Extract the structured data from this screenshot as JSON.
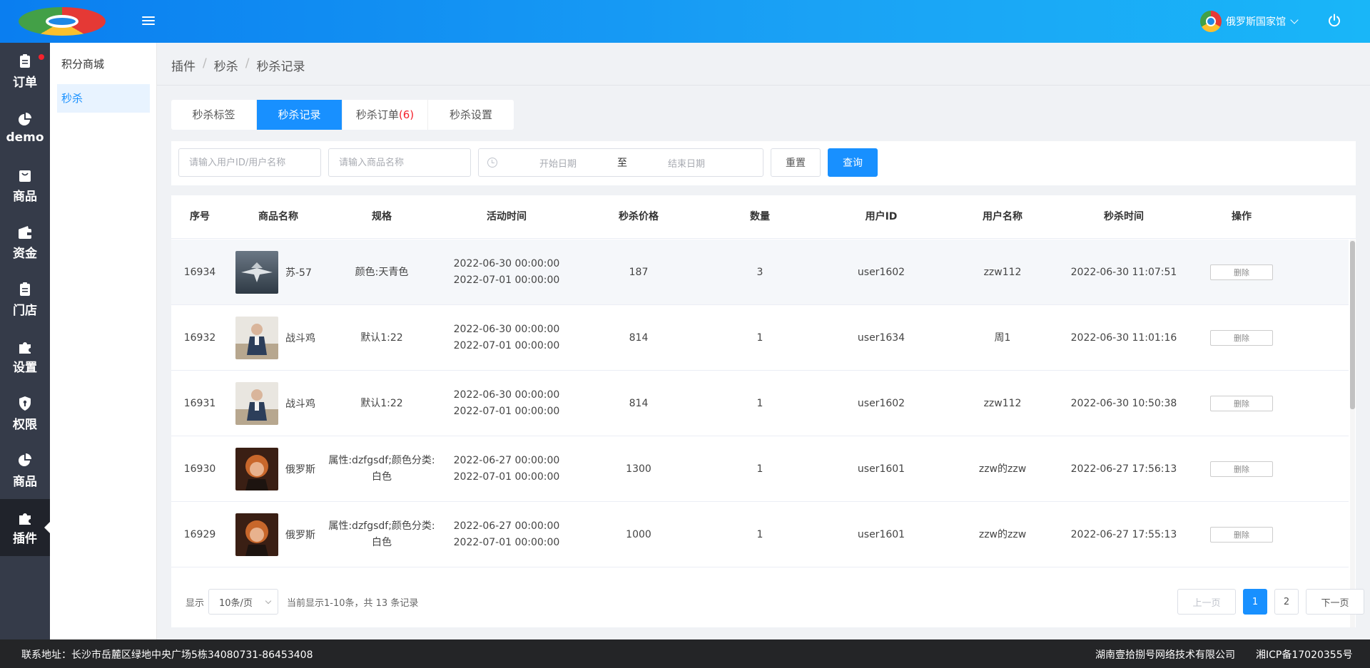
{
  "header": {
    "user_name": "俄罗斯国家馆"
  },
  "nav": {
    "items": [
      {
        "label": "订单",
        "icon": "clipboard-icon"
      },
      {
        "label": "demo",
        "icon": "pie-chart-icon"
      },
      {
        "label": "商品",
        "icon": "bag-icon"
      },
      {
        "label": "资金",
        "icon": "wallet-icon"
      },
      {
        "label": "门店",
        "icon": "clipboard-icon"
      },
      {
        "label": "设置",
        "icon": "puzzle-icon"
      },
      {
        "label": "权限",
        "icon": "shield-icon"
      },
      {
        "label": "商品",
        "icon": "pie-chart-icon"
      },
      {
        "label": "插件",
        "icon": "puzzle-icon"
      }
    ],
    "active_index": 8
  },
  "subnav": {
    "items": [
      "积分商城",
      "秒杀"
    ],
    "active_index": 1
  },
  "breadcrumb": [
    "插件",
    "秒杀",
    "秒杀记录"
  ],
  "tabs": [
    {
      "label": "秒杀标签"
    },
    {
      "label": "秒杀记录"
    },
    {
      "label": "秒杀订单",
      "count": "(6)"
    },
    {
      "label": "秒杀设置"
    }
  ],
  "filters": {
    "user_placeholder": "请输入用户ID/用户名称",
    "product_placeholder": "请输入商品名称",
    "start_date": "开始日期",
    "to": "至",
    "end_date": "结束日期",
    "reset": "重置",
    "query": "查询"
  },
  "table": {
    "columns": [
      "序号",
      "商品名称",
      "规格",
      "活动时间",
      "秒杀价格",
      "数量",
      "用户ID",
      "用户名称",
      "秒杀时间",
      "操作"
    ],
    "rows": [
      {
        "id": "16934",
        "name": "苏-57",
        "spec": "颜色:天青色",
        "start": "2022-06-30 00:00:00",
        "end": "2022-07-01 00:00:00",
        "price": "187",
        "qty": "3",
        "uid": "user1602",
        "uname": "zzw112",
        "time": "2022-06-30 11:07:51",
        "action": "删除"
      },
      {
        "id": "16932",
        "name": "战斗鸡",
        "spec": "默认1:22",
        "start": "2022-06-30 00:00:00",
        "end": "2022-07-01 00:00:00",
        "price": "814",
        "qty": "1",
        "uid": "user1634",
        "uname": "周1",
        "time": "2022-06-30 11:01:16",
        "action": "删除"
      },
      {
        "id": "16931",
        "name": "战斗鸡",
        "spec": "默认1:22",
        "start": "2022-06-30 00:00:00",
        "end": "2022-07-01 00:00:00",
        "price": "814",
        "qty": "1",
        "uid": "user1602",
        "uname": "zzw112",
        "time": "2022-06-30 10:50:38",
        "action": "删除"
      },
      {
        "id": "16930",
        "name": "俄罗斯",
        "spec": "属性:dzfgsdf;颜色分类:白色",
        "start": "2022-06-27 00:00:00",
        "end": "2022-07-01 00:00:00",
        "price": "1300",
        "qty": "1",
        "uid": "user1601",
        "uname": "zzw的zzw",
        "time": "2022-06-27 17:56:13",
        "action": "删除"
      },
      {
        "id": "16929",
        "name": "俄罗斯",
        "spec": "属性:dzfgsdf;颜色分类:白色",
        "start": "2022-06-27 00:00:00",
        "end": "2022-07-01 00:00:00",
        "price": "1000",
        "qty": "1",
        "uid": "user1601",
        "uname": "zzw的zzw",
        "time": "2022-06-27 17:55:13",
        "action": "删除"
      }
    ]
  },
  "pagination": {
    "show_label": "显示",
    "page_size": "10条/页",
    "summary": "当前显示1-10条，共 13 条记录",
    "prev": "上一页",
    "pages": [
      "1",
      "2"
    ],
    "current": "1",
    "next": "下一页"
  },
  "footer": {
    "address": "联系地址：长沙市岳麓区绿地中央广场5栋34080731-86453408",
    "company": "湖南壹拾捌号网络技术有限公司",
    "icp": "湘ICP备17020355号"
  },
  "colors": {
    "primary": "#1890ff",
    "sidebar": "#353b49",
    "sidebar_active": "#20232b",
    "badge": "#f5222d"
  }
}
